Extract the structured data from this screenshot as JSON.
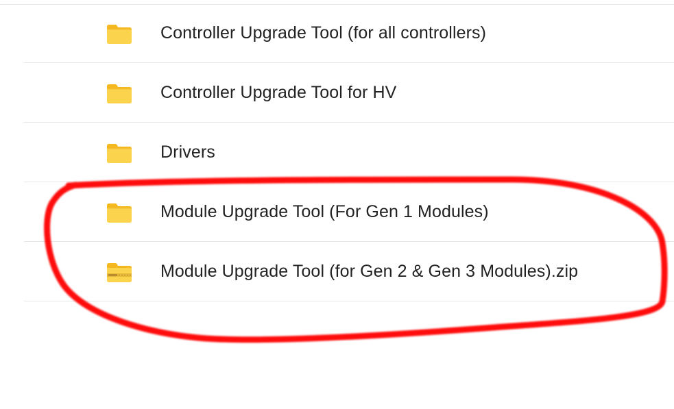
{
  "file_list": {
    "items": [
      {
        "name": "Controller Upgrade Tool (for all controllers)",
        "type": "folder",
        "icon": "folder-icon"
      },
      {
        "name": "Controller Upgrade Tool for HV",
        "type": "folder",
        "icon": "folder-icon"
      },
      {
        "name": "Drivers",
        "type": "folder",
        "icon": "folder-icon"
      },
      {
        "name": "Module Upgrade Tool (For Gen 1 Modules)",
        "type": "folder",
        "icon": "folder-icon"
      },
      {
        "name": "Module Upgrade Tool (for Gen 2 & Gen 3 Modules).zip",
        "type": "zip",
        "icon": "zip-folder-icon"
      }
    ]
  },
  "colors": {
    "folder_fill": "#FCD34D",
    "folder_tab": "#F5B820",
    "zip_stripe": "#B98A2E",
    "annotation_stroke": "#FF0000",
    "row_divider": "#E6E6E6",
    "text": "#222222"
  },
  "annotation": {
    "shape": "freehand-ellipse",
    "encircles": [
      "Module Upgrade Tool (For Gen 1 Modules)",
      "Module Upgrade Tool (for Gen 2 & Gen 3 Modules).zip"
    ]
  }
}
